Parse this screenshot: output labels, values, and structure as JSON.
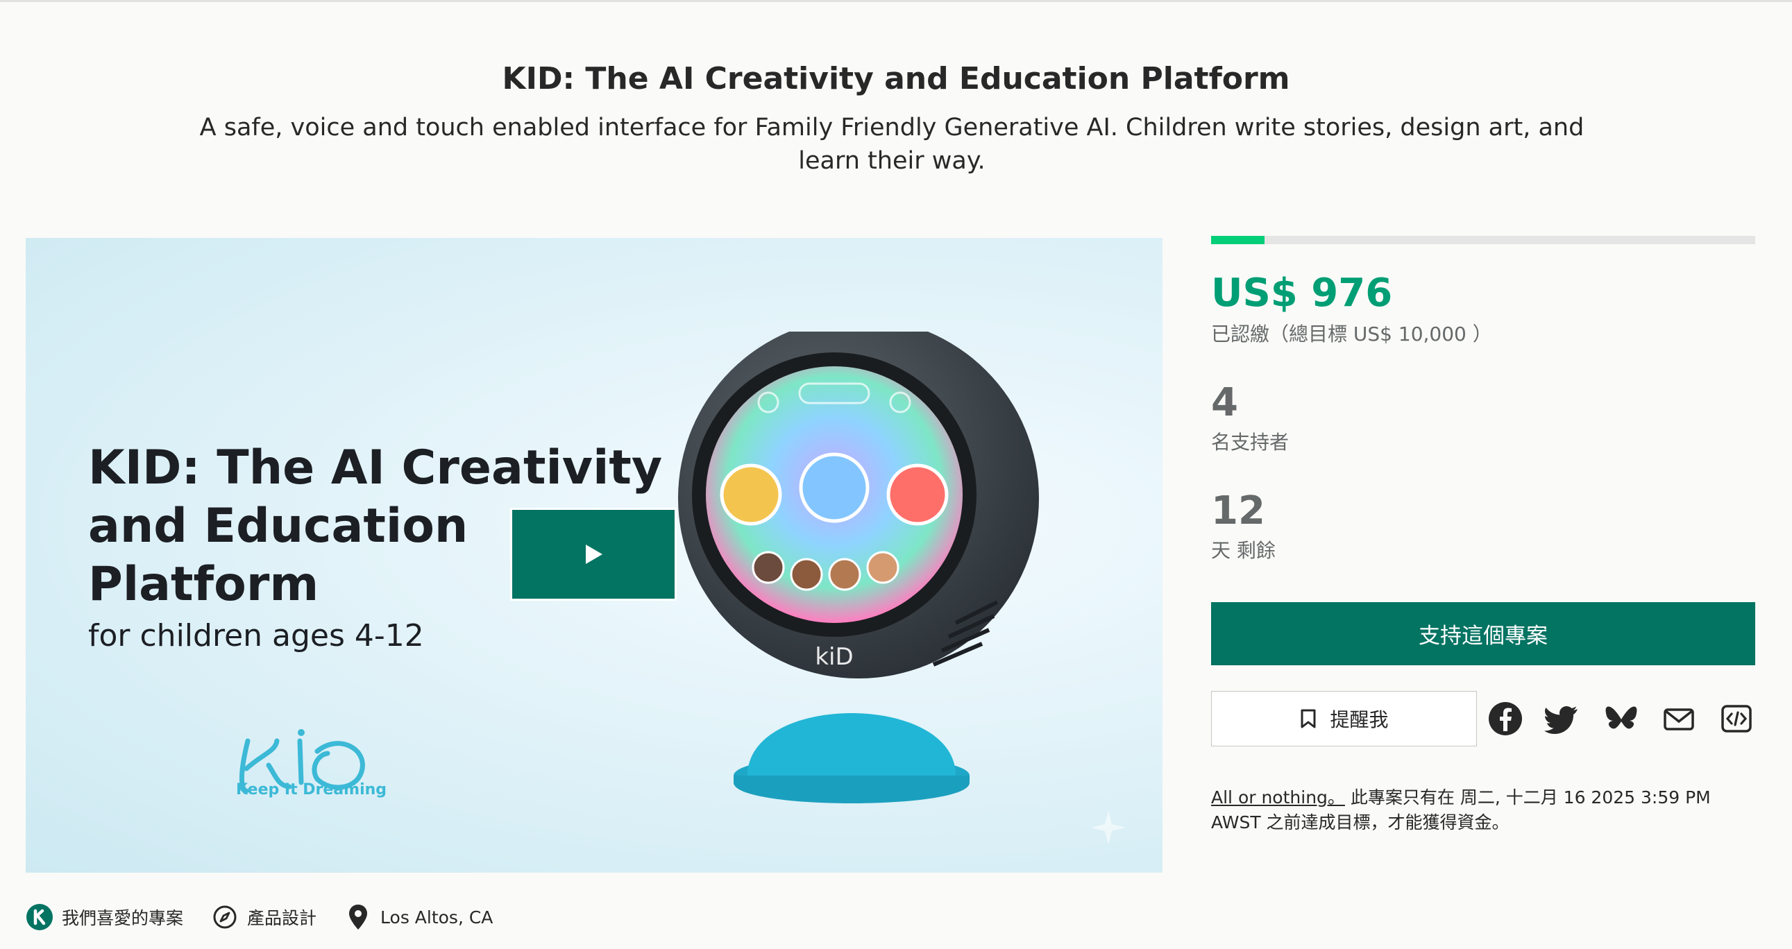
{
  "project": {
    "title": "KID: The AI Creativity and Education Platform",
    "blurb": "A safe, voice and touch enabled interface for Family Friendly Generative AI. Children write stories, design art, and learn their way."
  },
  "hero": {
    "headline": "KID: The AI Creativity and Education Platform",
    "subline": "for children ages 4-12",
    "logo_tagline": "Keep It Dreaming",
    "play_icon": "play-icon"
  },
  "funding": {
    "progress_fraction": 0.0976,
    "pledged": "US$ 976",
    "goal_text": "已認繳（總目標 US$ 10,000 ）",
    "backers_count": "4",
    "backers_label": "名支持者",
    "days_count": "12",
    "days_label": "天 剩餘"
  },
  "actions": {
    "back_label": "支持這個專案",
    "remind_label": "提醒我",
    "share_icons": [
      "facebook-icon",
      "twitter-icon",
      "bluesky-icon",
      "email-icon",
      "embed-icon"
    ]
  },
  "fineprint": {
    "link": "All or nothing。",
    "text": " 此專案只有在 周二, 十二月 16 2025 3:59 PM AWST 之前達成目標，才能獲得資金。"
  },
  "tags": [
    {
      "label": "我們喜愛的專案",
      "icon": "kickstarter-k-icon"
    },
    {
      "label": "產品設計",
      "icon": "compass-icon"
    },
    {
      "label": "Los Altos, CA",
      "icon": "location-pin-icon"
    }
  ],
  "colors": {
    "accent": "#037362",
    "pledged_green": "#009e74",
    "progress_green": "#05ce78",
    "muted": "#656969"
  }
}
